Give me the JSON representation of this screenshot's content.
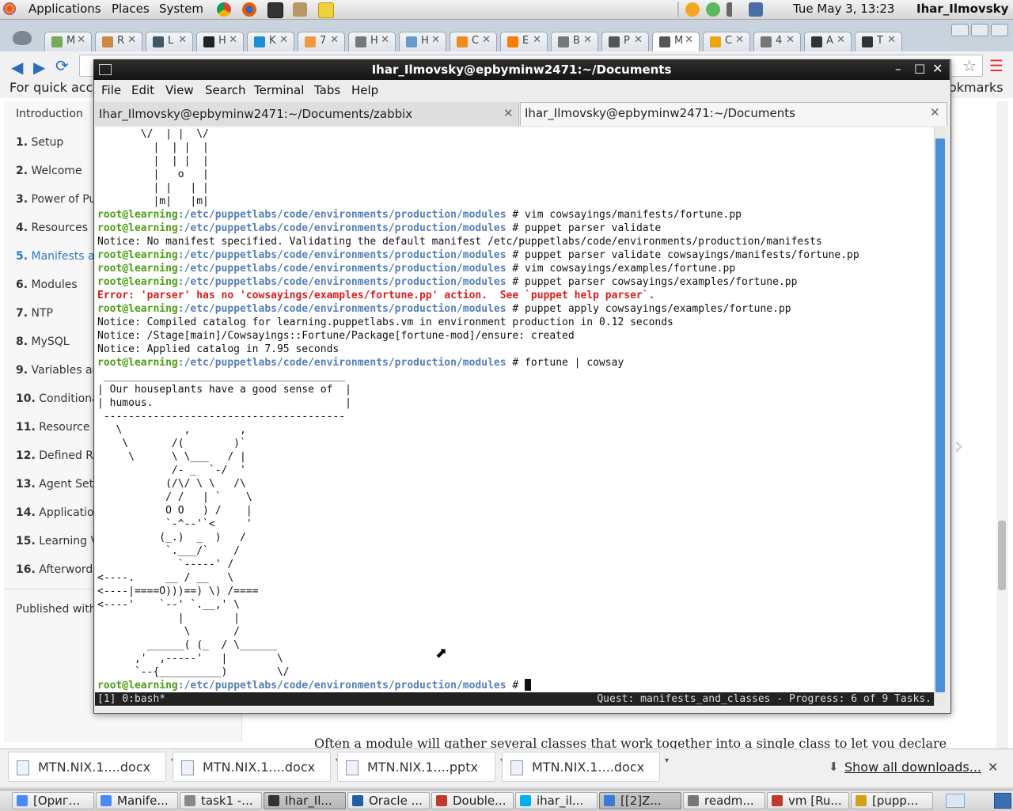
{
  "top_panel": {
    "applications": "Applications",
    "places": "Places",
    "system": "System",
    "clock": "Tue May  3, 13:23",
    "user": "Ihar_Ilmovsky"
  },
  "browser": {
    "bookmarks_left": "For quick acce",
    "bookmarks_right": "okmarks",
    "tabs": [
      {
        "title": "M",
        "color": "#7a5"
      },
      {
        "title": "R",
        "color": "#c84"
      },
      {
        "title": "L",
        "color": "#456"
      },
      {
        "title": "H",
        "color": "#222"
      },
      {
        "title": "K",
        "color": "#1a8fd1"
      },
      {
        "title": "7",
        "color": "#e94"
      },
      {
        "title": "H",
        "color": "#777"
      },
      {
        "title": "H",
        "color": "#6a9ac9"
      },
      {
        "title": "C",
        "color": "#f18b1a"
      },
      {
        "title": "E",
        "color": "#f57d00"
      },
      {
        "title": "B",
        "color": "#777"
      },
      {
        "title": "P",
        "color": "#555"
      },
      {
        "title": "M",
        "color": "#555"
      },
      {
        "title": "C",
        "color": "#f0a30a"
      },
      {
        "title": "4",
        "color": "#777"
      },
      {
        "title": "A",
        "color": "#333"
      },
      {
        "title": "T",
        "color": "#333"
      }
    ],
    "sidebar": [
      {
        "num": "",
        "label": "Introduction"
      },
      {
        "num": "1.",
        "label": "Setup"
      },
      {
        "num": "2.",
        "label": "Welcome"
      },
      {
        "num": "3.",
        "label": "Power of Pup"
      },
      {
        "num": "4.",
        "label": "Resources"
      },
      {
        "num": "5.",
        "label": "Manifests ar"
      },
      {
        "num": "6.",
        "label": "Modules"
      },
      {
        "num": "7.",
        "label": "NTP"
      },
      {
        "num": "8.",
        "label": "MySQL"
      },
      {
        "num": "9.",
        "label": "Variables an"
      },
      {
        "num": "10.",
        "label": "Conditiona"
      },
      {
        "num": "11.",
        "label": "Resource o"
      },
      {
        "num": "12.",
        "label": "Defined Re"
      },
      {
        "num": "13.",
        "label": "Agent Setu"
      },
      {
        "num": "14.",
        "label": "Application"
      },
      {
        "num": "15.",
        "label": "Learning V"
      },
      {
        "num": "16.",
        "label": "Afterword"
      }
    ],
    "sidebar_footer": "Published with",
    "content_text": "Often a module will gather several classes that work together into a single class to let you declare",
    "downloads": [
      "MTN.NIX.1....docx",
      "MTN.NIX.1....docx",
      "MTN.NIX.1....pptx",
      "MTN.NIX.1....docx"
    ],
    "show_all_downloads": "Show all downloads..."
  },
  "terminal": {
    "title": "Ihar_Ilmovsky@epbyminw2471:~/Documents",
    "menu": [
      "File",
      "Edit",
      "View",
      "Search",
      "Terminal",
      "Tabs",
      "Help"
    ],
    "tab1": "Ihar_Ilmovsky@epbyminw2471:~/Documents/zabbix",
    "tab2": "Ihar_Ilmovsky@epbyminw2471:~/Documents",
    "prompt_user": "root@learning",
    "prompt_path": ":/etc/puppetlabs/code/environments/production/modules",
    "lines": [
      {
        "t": "art",
        "text": "       \\/  | |  \\/"
      },
      {
        "t": "art",
        "text": "         |  | |  |"
      },
      {
        "t": "art",
        "text": "         |  | |  |"
      },
      {
        "t": "art",
        "text": "         |   o   |"
      },
      {
        "t": "art",
        "text": "         | |   | |"
      },
      {
        "t": "art",
        "text": "         |m|   |m|"
      },
      {
        "t": "cmd",
        "text": " # vim cowsayings/manifests/fortune.pp"
      },
      {
        "t": "cmd",
        "text": " # puppet parser validate"
      },
      {
        "t": "out",
        "text": "Notice: No manifest specified. Validating the default manifest /etc/puppetlabs/code/environments/production/manifests"
      },
      {
        "t": "cmd",
        "text": " # puppet parser validate cowsayings/manifests/fortune.pp"
      },
      {
        "t": "cmd",
        "text": " # vim cowsayings/examples/fortune.pp"
      },
      {
        "t": "cmd",
        "text": " # puppet parser cowsayings/examples/fortune.pp"
      },
      {
        "t": "err",
        "text": "Error: 'parser' has no 'cowsayings/examples/fortune.pp' action.  See `puppet help parser`."
      },
      {
        "t": "cmd",
        "text": " # puppet apply cowsayings/examples/fortune.pp"
      },
      {
        "t": "out",
        "text": "Notice: Compiled catalog for learning.puppetlabs.vm in environment production in 0.12 seconds"
      },
      {
        "t": "out",
        "text": "Notice: /Stage[main]/Cowsayings::Fortune/Package[fortune-mod]/ensure: created"
      },
      {
        "t": "out",
        "text": "Notice: Applied catalog in 7.95 seconds"
      },
      {
        "t": "cmd",
        "text": " # fortune | cowsay"
      },
      {
        "t": "art",
        "text": " _______________________________________"
      },
      {
        "t": "art",
        "text": "| Our houseplants have a good sense of  |"
      },
      {
        "t": "art",
        "text": "| humous.                               |"
      },
      {
        "t": "art",
        "text": " ---------------------------------------"
      },
      {
        "t": "art",
        "text": "   \\          ,        ,"
      },
      {
        "t": "art",
        "text": "    \\       /(        )`"
      },
      {
        "t": "art",
        "text": "     \\      \\ \\___   / |"
      },
      {
        "t": "art",
        "text": "            /- _  `-/  '"
      },
      {
        "t": "art",
        "text": "           (/\\/ \\ \\   /\\"
      },
      {
        "t": "art",
        "text": "           / /   | `    \\"
      },
      {
        "t": "art",
        "text": "           O O   ) /    |"
      },
      {
        "t": "art",
        "text": "           `-^--'`<     '"
      },
      {
        "t": "art",
        "text": "          (_.)  _  )   /"
      },
      {
        "t": "art",
        "text": "           `.___/`    /"
      },
      {
        "t": "art",
        "text": "             `-----' /"
      },
      {
        "t": "art",
        "text": "<----.     __ / __   \\"
      },
      {
        "t": "art",
        "text": "<----|====O)))==) \\) /===="
      },
      {
        "t": "art",
        "text": "<----'    `--' `.__,' \\"
      },
      {
        "t": "art",
        "text": "             |        |"
      },
      {
        "t": "art",
        "text": "              \\       /"
      },
      {
        "t": "art",
        "text": "        ______( (_  / \\______"
      },
      {
        "t": "art",
        "text": "      ,'  ,-----'   |        \\"
      },
      {
        "t": "art",
        "text": "      `--{__________)        \\/"
      },
      {
        "t": "cmd",
        "text": " # "
      }
    ],
    "status_left": "[1] 0:bash*",
    "status_right": "Quest: manifests_and_classes - Progress: 6 of 9 Tasks."
  },
  "taskbar": [
    {
      "label": "[Ориг...",
      "color": "#4a8af4"
    },
    {
      "label": "Manife...",
      "color": "#4a8af4"
    },
    {
      "label": "task1 -...",
      "color": "#888"
    },
    {
      "label": "Ihar_Il...",
      "color": "#333",
      "active": true
    },
    {
      "label": "Oracle ...",
      "color": "#1f5fa5"
    },
    {
      "label": "Double...",
      "color": "#c0392b"
    },
    {
      "label": "ihar_il...",
      "color": "#00aff0"
    },
    {
      "label": "[[2]Z...",
      "color": "#3a7bd5",
      "active": true
    },
    {
      "label": "readm...",
      "color": "#777"
    },
    {
      "label": "vm [Ru...",
      "color": "#c0392b"
    },
    {
      "label": "[pupp...",
      "color": "#d4a017"
    }
  ]
}
